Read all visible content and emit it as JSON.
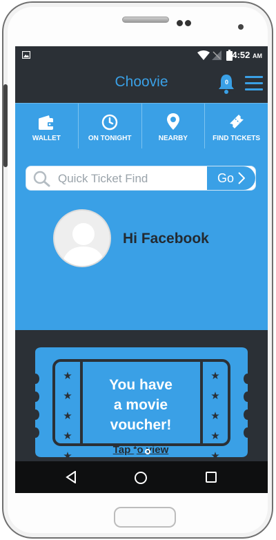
{
  "status_bar": {
    "time": "4:52",
    "ampm": "AM"
  },
  "app": {
    "title": "Choovie",
    "notification_count": "0"
  },
  "nav": [
    {
      "label": "WALLET",
      "icon": "wallet-icon"
    },
    {
      "label": "ON TONIGHT",
      "icon": "clock-icon"
    },
    {
      "label": "NEARBY",
      "icon": "location-pin-icon"
    },
    {
      "label": "FIND TICKETS",
      "icon": "ticket-icon"
    }
  ],
  "search": {
    "placeholder": "Quick Ticket Find",
    "button_label": "Go"
  },
  "profile": {
    "greeting": "Hi Facebook"
  },
  "voucher": {
    "line1": "You have",
    "line2": "a movie",
    "line3": "voucher!",
    "link": "Tap to view"
  },
  "carousel": {
    "pages": 2,
    "active": 1
  },
  "colors": {
    "primary": "#3aa0e6",
    "dark": "#2b3036",
    "nav_bar": "#0e0f10"
  }
}
